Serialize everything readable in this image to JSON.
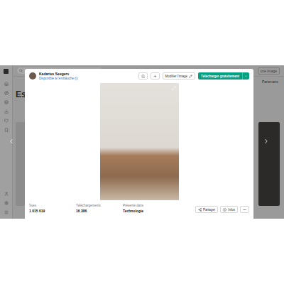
{
  "page": {
    "top_link": "une image",
    "nav_label": "Partenaire",
    "heading": "Es"
  },
  "modal": {
    "author": {
      "name": "Kadarius Seegers",
      "status": "Disponible à l'embauche",
      "verified": true
    },
    "actions": {
      "edit": "Modifier l'image",
      "download": "Télécharger gratuitement"
    },
    "stats": [
      {
        "label": "Vues",
        "value": "1 015 019"
      },
      {
        "label": "Téléchargements",
        "value": "16 386"
      },
      {
        "label": "Présenté dans",
        "value": "Technologie"
      }
    ],
    "footer_buttons": [
      "Partager",
      "Infos"
    ]
  }
}
